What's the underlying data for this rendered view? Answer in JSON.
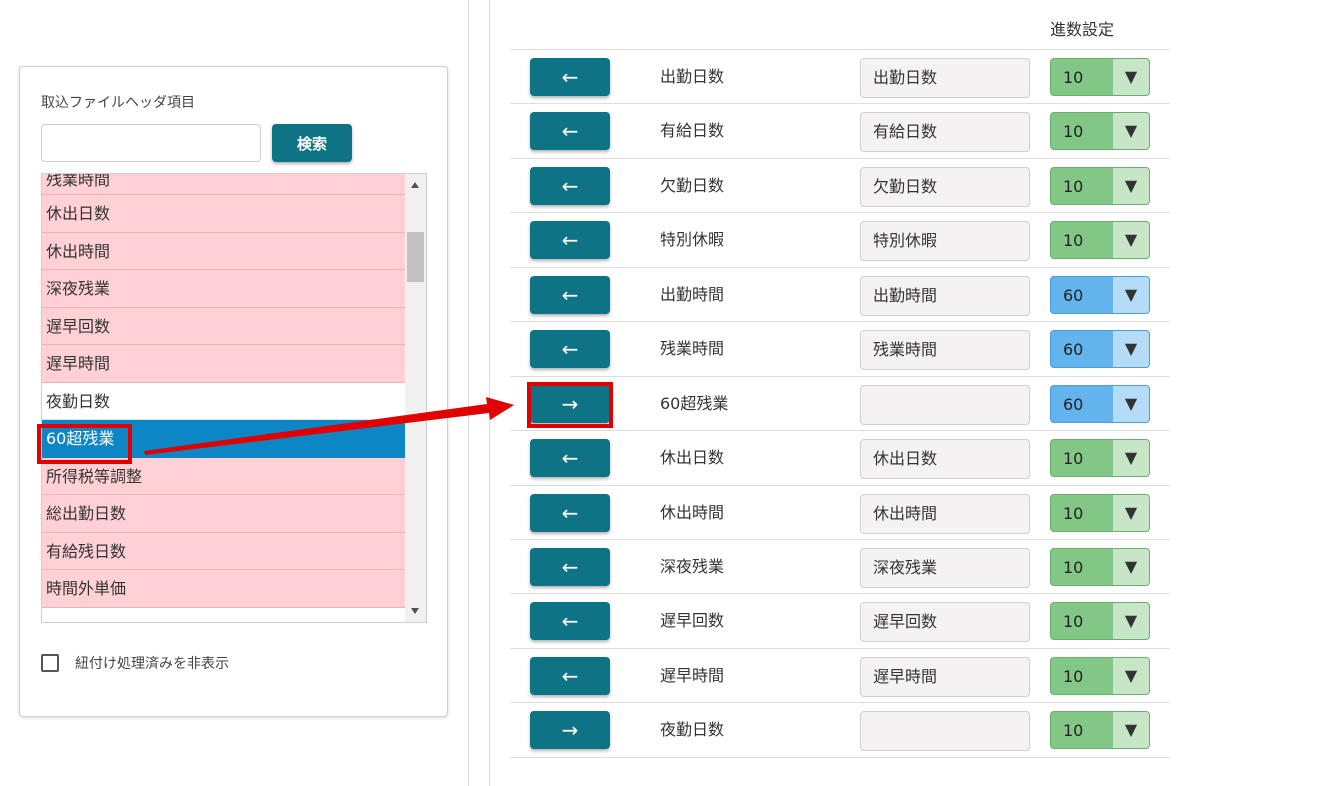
{
  "left_panel": {
    "title": "取込ファイルヘッダ項目",
    "search": {
      "value": "",
      "placeholder": ""
    },
    "search_button": "検索",
    "list": [
      {
        "label": "残業時間",
        "state": "mapped"
      },
      {
        "label": "休出日数",
        "state": "mapped"
      },
      {
        "label": "休出時間",
        "state": "mapped"
      },
      {
        "label": "深夜残業",
        "state": "mapped"
      },
      {
        "label": "遅早回数",
        "state": "mapped"
      },
      {
        "label": "遅早時間",
        "state": "mapped"
      },
      {
        "label": "夜勤日数",
        "state": "unmapped"
      },
      {
        "label": "60超残業",
        "state": "selected"
      },
      {
        "label": "所得税等調整",
        "state": "mapped"
      },
      {
        "label": "総出勤日数",
        "state": "mapped"
      },
      {
        "label": "有給残日数",
        "state": "mapped"
      },
      {
        "label": "時間外単価",
        "state": "mapped"
      }
    ],
    "hide_processed_label": "紐付け処理済みを非表示",
    "hide_processed_checked": false
  },
  "mapping": {
    "column_header": "進数設定",
    "rows": [
      {
        "arrow": "←",
        "source": "出勤日数",
        "target": "出勤日数",
        "radix": "10",
        "radix_color": "#82c786"
      },
      {
        "arrow": "←",
        "source": "有給日数",
        "target": "有給日数",
        "radix": "10",
        "radix_color": "#82c786"
      },
      {
        "arrow": "←",
        "source": "欠勤日数",
        "target": "欠勤日数",
        "radix": "10",
        "radix_color": "#82c786"
      },
      {
        "arrow": "←",
        "source": "特別休暇",
        "target": "特別休暇",
        "radix": "10",
        "radix_color": "#82c786"
      },
      {
        "arrow": "←",
        "source": "出勤時間",
        "target": "出勤時間",
        "radix": "60",
        "radix_color": "#63b3ed"
      },
      {
        "arrow": "←",
        "source": "残業時間",
        "target": "残業時間",
        "radix": "60",
        "radix_color": "#63b3ed"
      },
      {
        "arrow": "→",
        "source": "60超残業",
        "target": "",
        "radix": "60",
        "radix_color": "#63b3ed"
      },
      {
        "arrow": "←",
        "source": "休出日数",
        "target": "休出日数",
        "radix": "10",
        "radix_color": "#82c786"
      },
      {
        "arrow": "←",
        "source": "休出時間",
        "target": "休出時間",
        "radix": "10",
        "radix_color": "#82c786"
      },
      {
        "arrow": "←",
        "source": "深夜残業",
        "target": "深夜残業",
        "radix": "10",
        "radix_color": "#82c786"
      },
      {
        "arrow": "←",
        "source": "遅早回数",
        "target": "遅早回数",
        "radix": "10",
        "radix_color": "#82c786"
      },
      {
        "arrow": "←",
        "source": "遅早時間",
        "target": "遅早時間",
        "radix": "10",
        "radix_color": "#82c786"
      },
      {
        "arrow": "→",
        "source": "夜勤日数",
        "target": "",
        "radix": "10",
        "radix_color": "#82c786"
      }
    ]
  },
  "colors": {
    "accent": "#0f7386",
    "list_mapped": "#ffd1d6",
    "list_selected": "#0c86c5",
    "annotation": "#e00000"
  },
  "icons": {
    "select_arrow": "▼",
    "scroll_up": "scroll-up-arrow-icon",
    "scroll_down": "scroll-down-arrow-icon"
  }
}
